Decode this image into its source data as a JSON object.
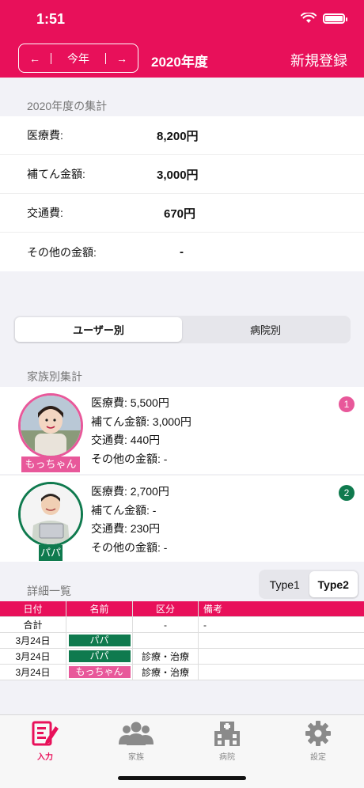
{
  "status_bar": {
    "time": "1:51"
  },
  "header": {
    "prev_arrow": "←",
    "next_arrow": "→",
    "current_label": "今年",
    "title": "2020年度",
    "new_button": "新規登録"
  },
  "summary": {
    "section_title": "2020年度の集計",
    "rows": [
      {
        "label": "医療費:",
        "value": "8,200円"
      },
      {
        "label": "補てん金額:",
        "value": "3,000円"
      },
      {
        "label": "交通費:",
        "value": "670円"
      },
      {
        "label": "その他の金額:",
        "value": "-"
      }
    ]
  },
  "view_segment": {
    "options": [
      "ユーザー別",
      "病院別"
    ],
    "selected": "ユーザー別"
  },
  "family": {
    "section_title": "家族別集計",
    "members": [
      {
        "name": "もっちゃん",
        "color": "#e8589a",
        "badge": "1",
        "lines": [
          "医療費: 5,500円",
          "補てん金額: 3,000円",
          "交通費: 440円",
          "その他の金額: -"
        ]
      },
      {
        "name": "パパ",
        "color": "#0f7a4e",
        "badge": "2",
        "lines": [
          "医療費: 2,700円",
          "補てん金額: -",
          "交通費: 230円",
          "その他の金額: -"
        ]
      }
    ]
  },
  "detail": {
    "section_title": "詳細一覧",
    "type_options": [
      "Type1",
      "Type2"
    ],
    "type_selected": "Type2",
    "columns": [
      "日付",
      "名前",
      "区分",
      "備考"
    ],
    "total_row": {
      "label": "合計",
      "category": "-",
      "note": "-"
    },
    "rows": [
      {
        "date": "3月24日",
        "name": "パパ",
        "category": "",
        "note": ""
      },
      {
        "date": "3月24日",
        "name": "パパ",
        "category": "診療・治療",
        "note": ""
      },
      {
        "date": "3月24日",
        "name": "もっちゃん",
        "category": "診療・治療",
        "note": ""
      }
    ]
  },
  "tabbar": {
    "items": [
      {
        "label": "入力",
        "icon": "pencil-note-icon",
        "active": true
      },
      {
        "label": "家族",
        "icon": "family-icon",
        "active": false
      },
      {
        "label": "病院",
        "icon": "hospital-icon",
        "active": false
      },
      {
        "label": "設定",
        "icon": "gear-icon",
        "active": false
      }
    ]
  },
  "colors": {
    "accent": "#e8105a",
    "mocchan": "#e8589a",
    "papa": "#0f7a4e"
  }
}
